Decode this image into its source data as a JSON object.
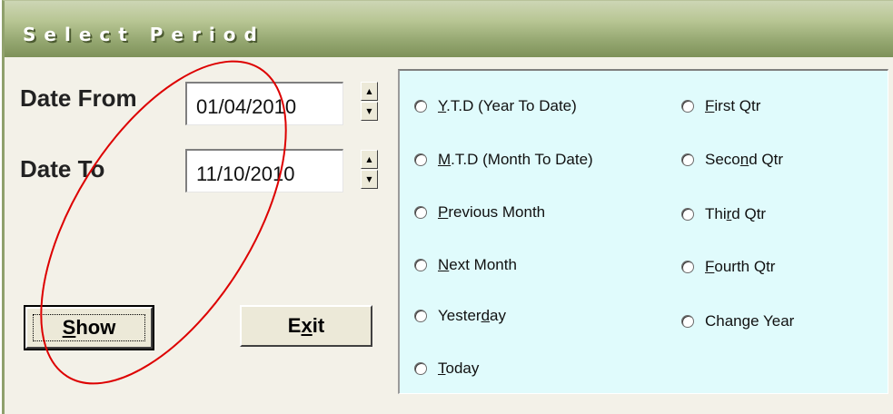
{
  "window": {
    "title": "Select Period"
  },
  "dates": {
    "from_label": "Date From",
    "from_value": "01/04/2010",
    "to_label": "Date To",
    "to_value": "11/10/2010"
  },
  "buttons": {
    "show_pre": "",
    "show_hot": "S",
    "show_post": "how",
    "exit_pre": "E",
    "exit_hot": "x",
    "exit_post": "it"
  },
  "options": {
    "ytd": {
      "hot": "Y",
      "rest": ".T.D (Year To Date)"
    },
    "mtd": {
      "hot": "M",
      "rest": ".T.D (Month To Date)"
    },
    "prev_month": {
      "hot": "P",
      "rest": "revious Month"
    },
    "next_month": {
      "hot": "N",
      "rest": "ext Month"
    },
    "yesterday": {
      "pre": "Yester",
      "hot": "d",
      "rest": "ay"
    },
    "today": {
      "hot": "T",
      "rest": "oday"
    },
    "first_qtr": {
      "hot": "F",
      "rest": "irst Qtr"
    },
    "second_qtr": {
      "pre": "Seco",
      "hot": "n",
      "rest": "d Qtr"
    },
    "third_qtr": {
      "pre": "Thi",
      "hot": "r",
      "rest": "d Qtr"
    },
    "fourth_qtr": {
      "hot": "F",
      "rest": "ourth Qtr"
    },
    "change_year": {
      "label": "Change Year"
    }
  },
  "colors": {
    "titlebar": "#96a872",
    "panel_bg": "#e0fbfc",
    "window_bg": "#f3f1e8",
    "annotation": "#dd0000"
  }
}
